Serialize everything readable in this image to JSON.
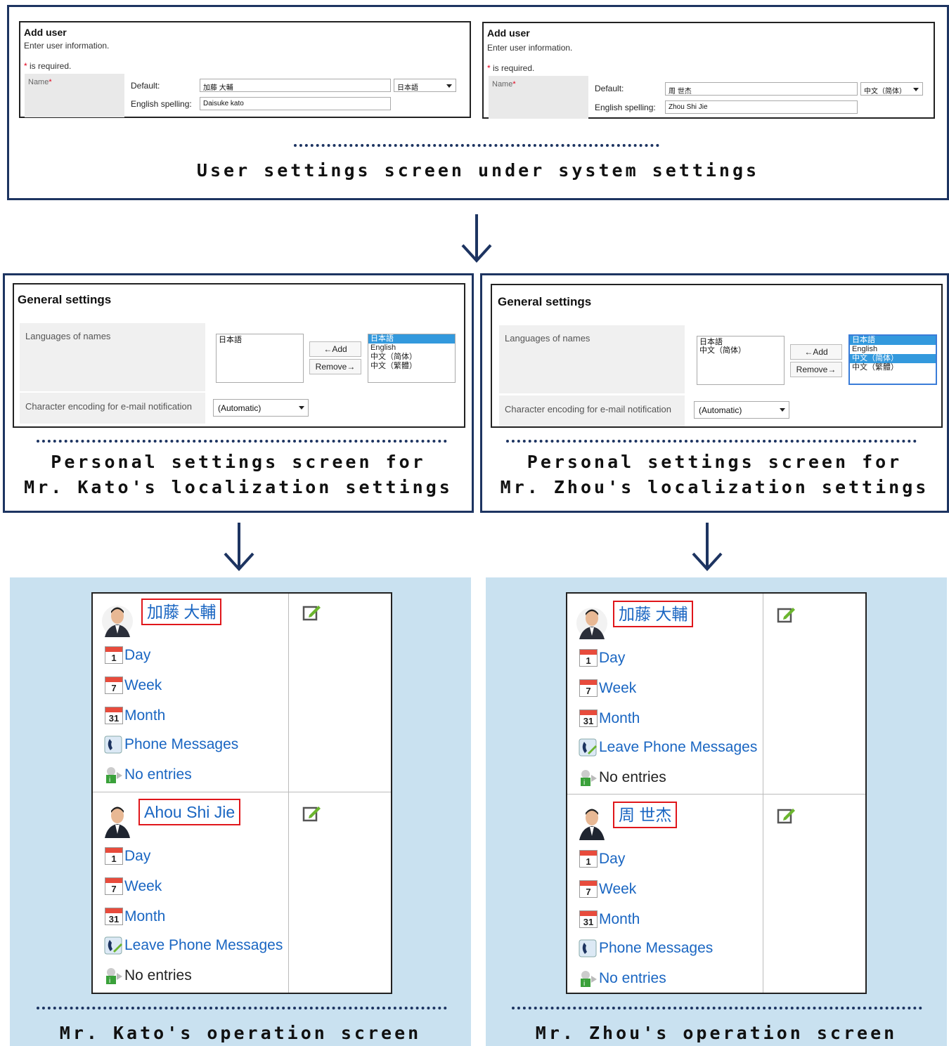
{
  "top": {
    "caption": "User settings screen under system settings",
    "left": {
      "title": "Add user",
      "subtitle": "Enter user information.",
      "required_mark": "*",
      "required_text": " is required.",
      "name_label": "Name",
      "default_label": "Default:",
      "default_value": "加藤 大輔",
      "language_value": "日本語",
      "english_label": "English spelling:",
      "english_value": "Daisuke kato"
    },
    "right": {
      "title": "Add user",
      "subtitle": "Enter user information.",
      "required_mark": "*",
      "required_text": " is required.",
      "name_label": "Name",
      "default_label": "Default:",
      "default_value": "周 世杰",
      "language_value": "中文（简体）",
      "english_label": "English spelling:",
      "english_value": "Zhou Shi Jie"
    }
  },
  "middle": {
    "left": {
      "title": "General settings",
      "languages_label": "Languages of names",
      "selected_languages": [
        "日本語"
      ],
      "add_button": "←Add",
      "remove_button": "Remove→",
      "available_languages": [
        "日本語",
        "English",
        "中文（简体）",
        "中文（繁體）"
      ],
      "highlighted_index": 0,
      "encoding_label": "Character encoding for e-mail notification",
      "encoding_value": "(Automatic)",
      "caption_line1": "Personal settings screen for",
      "caption_line2": "Mr. Kato's localization settings"
    },
    "right": {
      "title": "General settings",
      "languages_label": "Languages of names",
      "selected_languages": [
        "日本語",
        "中文（简体）"
      ],
      "add_button": "←Add",
      "remove_button": "Remove→",
      "available_languages": [
        "日本語",
        "English",
        "中文（简体）",
        "中文（繁體）"
      ],
      "highlighted_indices": [
        0,
        2
      ],
      "encoding_label": "Character encoding for e-mail notification",
      "encoding_value": "(Automatic)",
      "caption_line1": "Personal settings screen for",
      "caption_line2": "Mr. Zhou's localization settings"
    }
  },
  "bottom": {
    "left": {
      "caption": "Mr. Kato's operation screen",
      "users": [
        {
          "name": "加藤 大輔",
          "items": [
            {
              "icon": "calendar-day-icon",
              "icon_text": "1",
              "label": "Day"
            },
            {
              "icon": "calendar-week-icon",
              "icon_text": "7",
              "label": "Week"
            },
            {
              "icon": "calendar-month-icon",
              "icon_text": "31",
              "label": "Month"
            },
            {
              "icon": "phone-message-icon",
              "label": "Phone Messages"
            },
            {
              "icon": "presence-icon",
              "label": "No entries"
            }
          ]
        },
        {
          "name": "Ahou Shi Jie",
          "items": [
            {
              "icon": "calendar-day-icon",
              "icon_text": "1",
              "label": "Day"
            },
            {
              "icon": "calendar-week-icon",
              "icon_text": "7",
              "label": "Week"
            },
            {
              "icon": "calendar-month-icon",
              "icon_text": "31",
              "label": "Month"
            },
            {
              "icon": "phone-message-icon",
              "label": "Leave Phone Messages"
            },
            {
              "icon": "presence-icon",
              "label": "No entries"
            }
          ]
        }
      ]
    },
    "right": {
      "caption": "Mr. Zhou's operation screen",
      "users": [
        {
          "name": "加藤 大輔",
          "items": [
            {
              "icon": "calendar-day-icon",
              "icon_text": "1",
              "label": "Day"
            },
            {
              "icon": "calendar-week-icon",
              "icon_text": "7",
              "label": "Week"
            },
            {
              "icon": "calendar-month-icon",
              "icon_text": "31",
              "label": "Month"
            },
            {
              "icon": "phone-message-icon",
              "label": "Leave Phone Messages"
            },
            {
              "icon": "presence-icon",
              "label": "No entries"
            }
          ]
        },
        {
          "name": "周 世杰",
          "items": [
            {
              "icon": "calendar-day-icon",
              "icon_text": "1",
              "label": "Day"
            },
            {
              "icon": "calendar-week-icon",
              "icon_text": "7",
              "label": "Week"
            },
            {
              "icon": "calendar-month-icon",
              "icon_text": "31",
              "label": "Month"
            },
            {
              "icon": "phone-message-icon",
              "label": "Phone Messages"
            },
            {
              "icon": "presence-icon",
              "label": "No entries"
            }
          ]
        }
      ]
    }
  },
  "colors": {
    "frame": "#1d3461",
    "link": "#1a66c2",
    "highlight_border": "#e0161b",
    "operation_background": "#c9e1f0",
    "list_selection": "#3399dd"
  }
}
